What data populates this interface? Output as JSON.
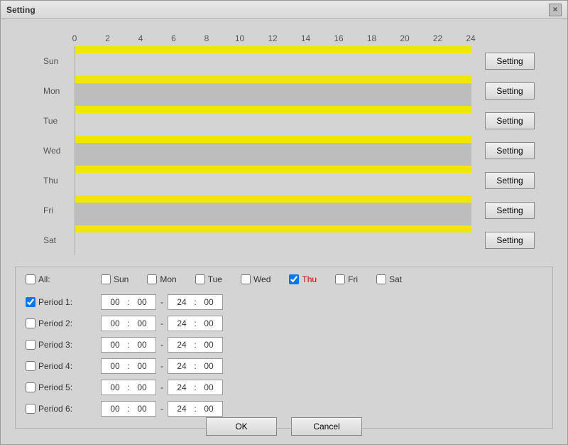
{
  "dialog": {
    "title": "Setting",
    "close_label": "×"
  },
  "axis": [
    "0",
    "2",
    "4",
    "6",
    "8",
    "10",
    "12",
    "14",
    "16",
    "18",
    "20",
    "22",
    "24"
  ],
  "days": [
    {
      "label": "Sun",
      "alt": false,
      "button": "Setting"
    },
    {
      "label": "Mon",
      "alt": true,
      "button": "Setting"
    },
    {
      "label": "Tue",
      "alt": false,
      "button": "Setting"
    },
    {
      "label": "Wed",
      "alt": true,
      "button": "Setting"
    },
    {
      "label": "Thu",
      "alt": false,
      "button": "Setting"
    },
    {
      "label": "Fri",
      "alt": true,
      "button": "Setting"
    },
    {
      "label": "Sat",
      "alt": false,
      "button": "Setting"
    }
  ],
  "checks": {
    "all_label": "All:",
    "all_checked": false,
    "items": [
      {
        "label": "Sun",
        "checked": false,
        "highlight": false
      },
      {
        "label": "Mon",
        "checked": false,
        "highlight": false
      },
      {
        "label": "Tue",
        "checked": false,
        "highlight": false
      },
      {
        "label": "Wed",
        "checked": false,
        "highlight": false
      },
      {
        "label": "Thu",
        "checked": true,
        "highlight": true
      },
      {
        "label": "Fri",
        "checked": false,
        "highlight": false
      },
      {
        "label": "Sat",
        "checked": false,
        "highlight": false
      }
    ]
  },
  "periods": [
    {
      "label": "Period 1:",
      "checked": true,
      "from_h": "00",
      "from_m": "00",
      "to_h": "24",
      "to_m": "00"
    },
    {
      "label": "Period 2:",
      "checked": false,
      "from_h": "00",
      "from_m": "00",
      "to_h": "24",
      "to_m": "00"
    },
    {
      "label": "Period 3:",
      "checked": false,
      "from_h": "00",
      "from_m": "00",
      "to_h": "24",
      "to_m": "00"
    },
    {
      "label": "Period 4:",
      "checked": false,
      "from_h": "00",
      "from_m": "00",
      "to_h": "24",
      "to_m": "00"
    },
    {
      "label": "Period 5:",
      "checked": false,
      "from_h": "00",
      "from_m": "00",
      "to_h": "24",
      "to_m": "00"
    },
    {
      "label": "Period 6:",
      "checked": false,
      "from_h": "00",
      "from_m": "00",
      "to_h": "24",
      "to_m": "00"
    }
  ],
  "footer": {
    "ok": "OK",
    "cancel": "Cancel"
  }
}
